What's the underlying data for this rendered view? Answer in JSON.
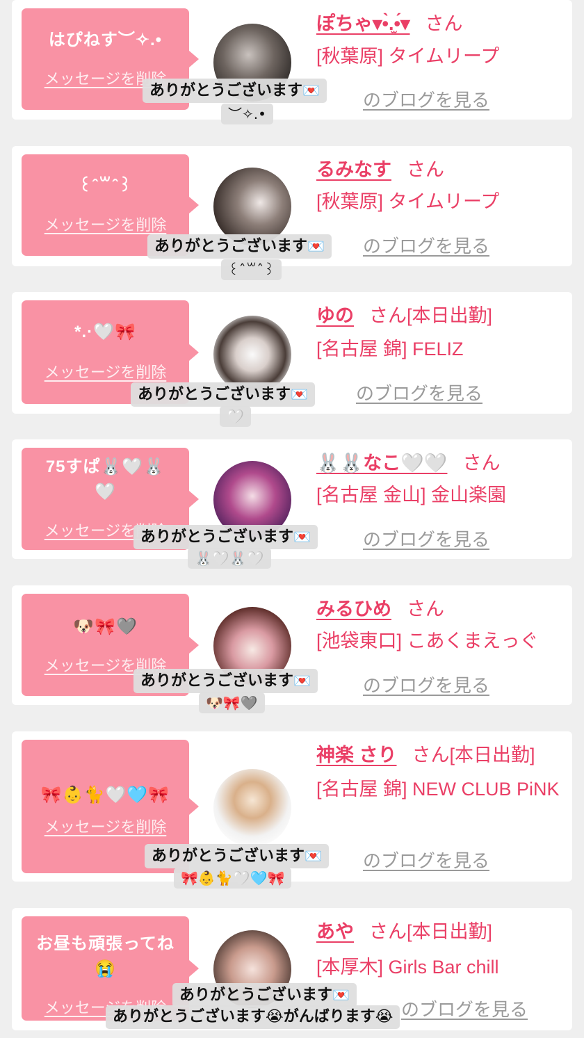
{
  "common": {
    "delete_label": "メッセージを削除",
    "san": "さん",
    "blog_label": "のブログを見る",
    "thanks": "ありがとうございます",
    "envelope_icon": "💌"
  },
  "colors": {
    "bubble": "#f992a4",
    "name": "#ea3f66",
    "blog": "#9a9a9a",
    "background": "#efefef"
  },
  "cards": [
    {
      "message": "はぴねす︶✧.•",
      "name": "ぽちゃ▾•̀.̫•́▾",
      "today": "",
      "shop": "[秋葉原] タイムリープ",
      "reply_sub": "︶✧.•"
    },
    {
      "message": "꒰ˆ꒳ˆ꒱",
      "name": "るみなす",
      "today": "",
      "shop": "[秋葉原] タイムリープ",
      "reply_sub": "꒰ˆ꒳ˆ꒱"
    },
    {
      "message": "*.·🤍🎀",
      "name": "ゆの",
      "today": "[本日出勤]",
      "shop": "[名古屋 錦] FELIZ",
      "reply_sub": "🤍"
    },
    {
      "message": "75すぱ🐰🤍🐰🤍",
      "name": "🐰🐰なこ🤍🤍",
      "today": "",
      "shop": "[名古屋 金山] 金山楽園",
      "reply_sub": "🐰🤍🐰🤍"
    },
    {
      "message": "🐶🎀🩶",
      "name": "みるひめ",
      "today": "",
      "shop": "[池袋東口] こあくまえっぐ",
      "reply_sub": "🐶🎀🩶"
    },
    {
      "message": "🎀👶🐈🤍🩵🎀",
      "name": "神楽 さり",
      "today": "[本日出勤]",
      "shop": "[名古屋 錦] NEW CLUB PiNK",
      "reply_sub": "🎀👶🐈🤍🩵🎀"
    },
    {
      "message": "お昼も頑張ってね😭",
      "name": "あや",
      "today": "[本日出勤]",
      "shop": "[本厚木] Girls Bar chill",
      "reply_sub": "ありがとうございます😭がんばります😭"
    }
  ]
}
